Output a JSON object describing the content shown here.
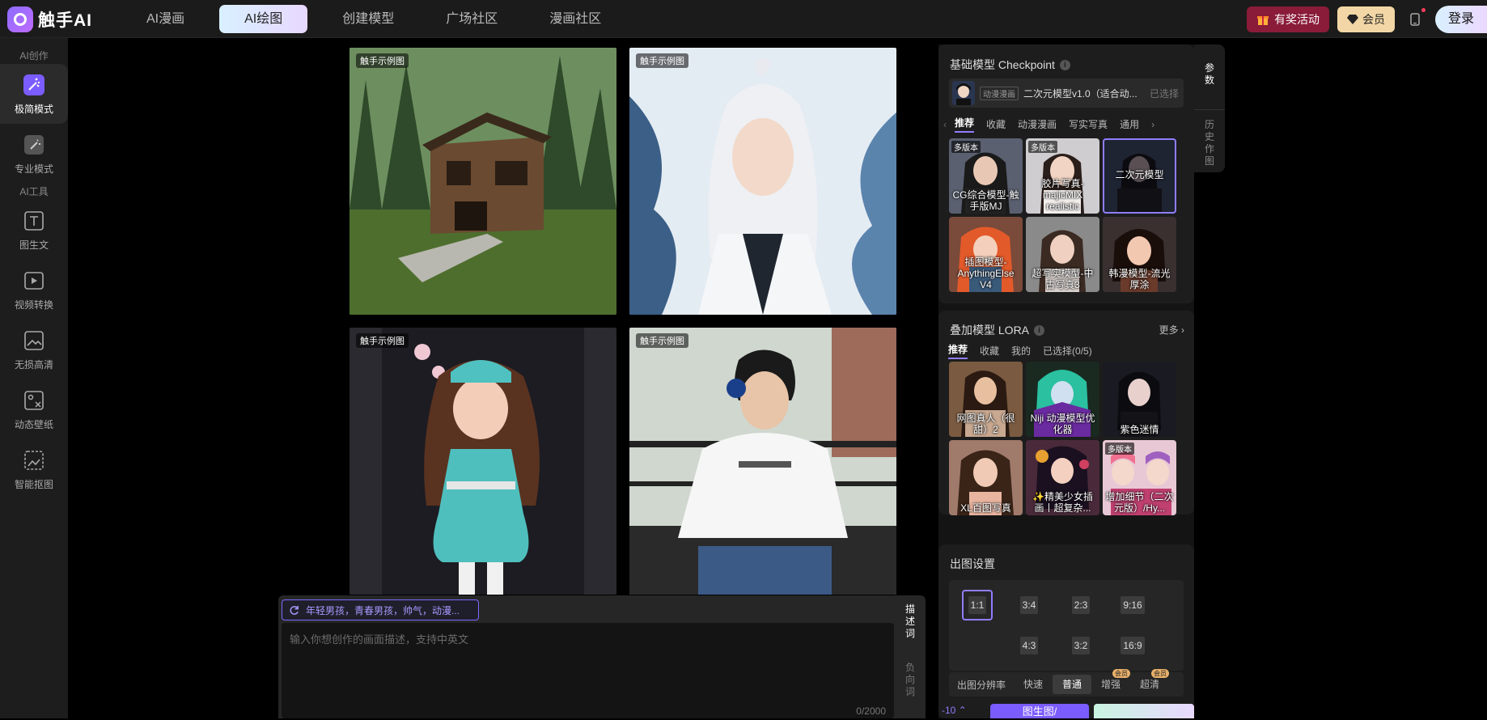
{
  "app": {
    "name": "触手AI"
  },
  "nav": {
    "items": [
      "AI漫画",
      "AI绘图",
      "创建模型",
      "广场社区",
      "漫画社区"
    ],
    "active_index": 1
  },
  "topbar": {
    "event_label": "有奖活动",
    "vip_label": "会员",
    "login_label": "登录"
  },
  "sidebar": {
    "group_create": "AI创作",
    "group_tools": "AI工具",
    "items": [
      "极简模式",
      "专业模式",
      "图生文",
      "视频转换",
      "无损高清",
      "动态壁纸",
      "智能抠图"
    ],
    "active_index": 0
  },
  "gallery": {
    "tag": "触手示例图"
  },
  "prompt": {
    "suggestion": "年轻男孩，青春男孩，帅气，动漫...",
    "placeholder": "输入你想创作的画面描述，支持中英文",
    "counter": "0/2000",
    "tab_positive": "描述词",
    "tab_negative": "负向词"
  },
  "checkpoint": {
    "title": "基础模型 Checkpoint",
    "selected_badge": "动漫漫画",
    "selected_name": "二次元模型v1.0（适合动...",
    "selected_state": "已选择",
    "tabs": [
      "推荐",
      "收藏",
      "动漫漫画",
      "写实写真",
      "通用"
    ],
    "models": [
      {
        "name": "CG综合模型-触手版MJ",
        "badge": "多版本"
      },
      {
        "name": "胶片写真-majicMIX realistic",
        "badge": "多版本"
      },
      {
        "name": "二次元模型",
        "badge": ""
      },
      {
        "name": "插图模型-AnythingElse V4",
        "badge": ""
      },
      {
        "name": "超写实模型-中古写真3",
        "badge": ""
      },
      {
        "name": "韩漫模型-流光厚涂",
        "badge": ""
      }
    ]
  },
  "lora": {
    "title": "叠加模型 LORA",
    "more": "更多",
    "tabs": [
      "推荐",
      "收藏",
      "我的",
      "已选择(0/5)"
    ],
    "models": [
      {
        "name": "网图真人（很甜）2",
        "badge": ""
      },
      {
        "name": "Niji 动漫模型优化器",
        "badge": ""
      },
      {
        "name": "紫色迷情",
        "badge": ""
      },
      {
        "name": "XL百图写真",
        "badge": ""
      },
      {
        "name": "✨精美少女插画丨超复杂...",
        "badge": ""
      },
      {
        "name": "增加细节（二次元版）/Hy...",
        "badge": "多版本"
      }
    ]
  },
  "output": {
    "title": "出图设置",
    "ratios": [
      "1:1",
      "3:4",
      "2:3",
      "9:16",
      "4:3",
      "3:2",
      "16:9"
    ],
    "selected_ratio": "1:1",
    "resolution_label": "出图分辨率",
    "resolutions": [
      "快速",
      "普通",
      "增强",
      "超清"
    ],
    "selected_resolution": "普通",
    "vip_tag": "会员"
  },
  "right_tabs": {
    "params": "参数",
    "history": "历史作图"
  },
  "bottom": {
    "credits": "-10",
    "generate_label": "图生图/"
  },
  "colors": {
    "accent": "#8f7dff",
    "event_bg": "#8a1b39",
    "vip_bg": "#f3d6a6"
  }
}
